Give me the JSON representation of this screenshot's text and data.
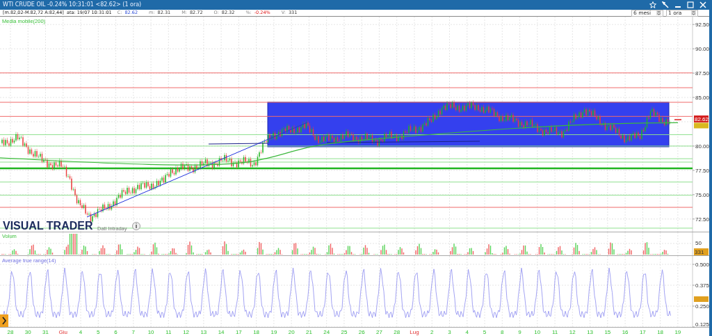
{
  "window": {
    "title": "WTI CRUDE OIL -0.24% 10:31:01 <82.62> (1 ora)"
  },
  "quote_bar": {
    "range": "[m.82,02-M.82,72 A:82,44]",
    "date": "ata: 19/07 10:31:01",
    "fields": [
      {
        "label": "C:",
        "value": "82.62",
        "kind": "close"
      },
      {
        "label": "m:",
        "value": "82.31",
        "kind": "plain"
      },
      {
        "label": "M:",
        "value": "82.72",
        "kind": "plain"
      },
      {
        "label": "O:",
        "value": "82.32",
        "kind": "plain"
      },
      {
        "label": "%:",
        "value": "-0.24%",
        "kind": "change"
      },
      {
        "label": "V:",
        "value": "331",
        "kind": "plain"
      }
    ]
  },
  "selectors": [
    {
      "value": "6 mesi"
    },
    {
      "value": "1 ora"
    }
  ],
  "price_panel": {
    "indicator": "Media mobile(200)",
    "ticks": [
      "92.50",
      "90.00",
      "87.50",
      "85.00",
      "80.00",
      "77.50",
      "75.00",
      "72.50"
    ],
    "last_price": "82.62",
    "logo": "VISUAL TRADER",
    "source": "Dati Intraday"
  },
  "volume_panel": {
    "label": "Volum",
    "ticks": [
      "50"
    ],
    "last_volume": "331"
  },
  "atr_panel": {
    "label": "Average true range(14)",
    "ticks": [
      "0.500",
      "0.375",
      "0.250",
      "0.125"
    ]
  },
  "x_axis": [
    {
      "label": "28",
      "kind": "day"
    },
    {
      "label": "30",
      "kind": "day"
    },
    {
      "label": "31",
      "kind": "day"
    },
    {
      "label": "Giu",
      "kind": "month"
    },
    {
      "label": "4",
      "kind": "day"
    },
    {
      "label": "5",
      "kind": "day"
    },
    {
      "label": "6",
      "kind": "day"
    },
    {
      "label": "7",
      "kind": "day"
    },
    {
      "label": "10",
      "kind": "day"
    },
    {
      "label": "11",
      "kind": "day"
    },
    {
      "label": "12",
      "kind": "day"
    },
    {
      "label": "13",
      "kind": "day"
    },
    {
      "label": "14",
      "kind": "day"
    },
    {
      "label": "17",
      "kind": "day"
    },
    {
      "label": "18",
      "kind": "day"
    },
    {
      "label": "19",
      "kind": "day"
    },
    {
      "label": "20",
      "kind": "day"
    },
    {
      "label": "21",
      "kind": "day"
    },
    {
      "label": "24",
      "kind": "day"
    },
    {
      "label": "25",
      "kind": "day"
    },
    {
      "label": "26",
      "kind": "day"
    },
    {
      "label": "27",
      "kind": "day"
    },
    {
      "label": "28",
      "kind": "day"
    },
    {
      "label": "Lug",
      "kind": "month"
    },
    {
      "label": "2",
      "kind": "day"
    },
    {
      "label": "3",
      "kind": "day"
    },
    {
      "label": "4",
      "kind": "day"
    },
    {
      "label": "5",
      "kind": "day"
    },
    {
      "label": "8",
      "kind": "day"
    },
    {
      "label": "9",
      "kind": "day"
    },
    {
      "label": "10",
      "kind": "day"
    },
    {
      "label": "11",
      "kind": "day"
    },
    {
      "label": "12",
      "kind": "day"
    },
    {
      "label": "13",
      "kind": "day"
    },
    {
      "label": "15",
      "kind": "day"
    },
    {
      "label": "16",
      "kind": "day"
    },
    {
      "label": "17",
      "kind": "day"
    },
    {
      "label": "18",
      "kind": "day"
    },
    {
      "label": "19",
      "kind": "day"
    }
  ]
}
